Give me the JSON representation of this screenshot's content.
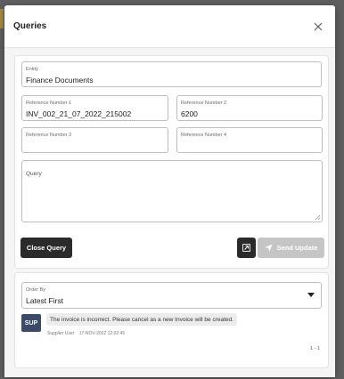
{
  "dialog": {
    "title": "Queries",
    "close_icon": "close-icon"
  },
  "form": {
    "entity": {
      "label": "Entity",
      "value": "Finance Documents"
    },
    "ref1": {
      "label": "Reference Number 1",
      "value": "INV_002_21_07_2022_215002"
    },
    "ref2": {
      "label": "Reference Number 2",
      "value": "6200"
    },
    "ref3": {
      "label": "Reference Number 3",
      "value": ""
    },
    "ref4": {
      "label": "Reference Number 4",
      "value": ""
    },
    "query": {
      "label": "Query",
      "value": ""
    }
  },
  "actions": {
    "close_query": "Close Query",
    "expand_icon": "external-link-icon",
    "send_update": "Send Update",
    "send_icon": "paper-plane-icon"
  },
  "thread": {
    "order_by_label": "Order By",
    "order_by_value": "Latest First",
    "messages": [
      {
        "avatar": "SUP",
        "text": "The invoice is incorrect. Please cancel as a new Invoice will be created.",
        "author": "Supplier User",
        "timestamp": "17-NOV-2022 12:02:45"
      }
    ],
    "pagination": "1 - 1"
  },
  "colors": {
    "primary_button": "#2b2b2b",
    "disabled_button": "#c5c5c5",
    "avatar_bg": "#3b4a6b"
  }
}
